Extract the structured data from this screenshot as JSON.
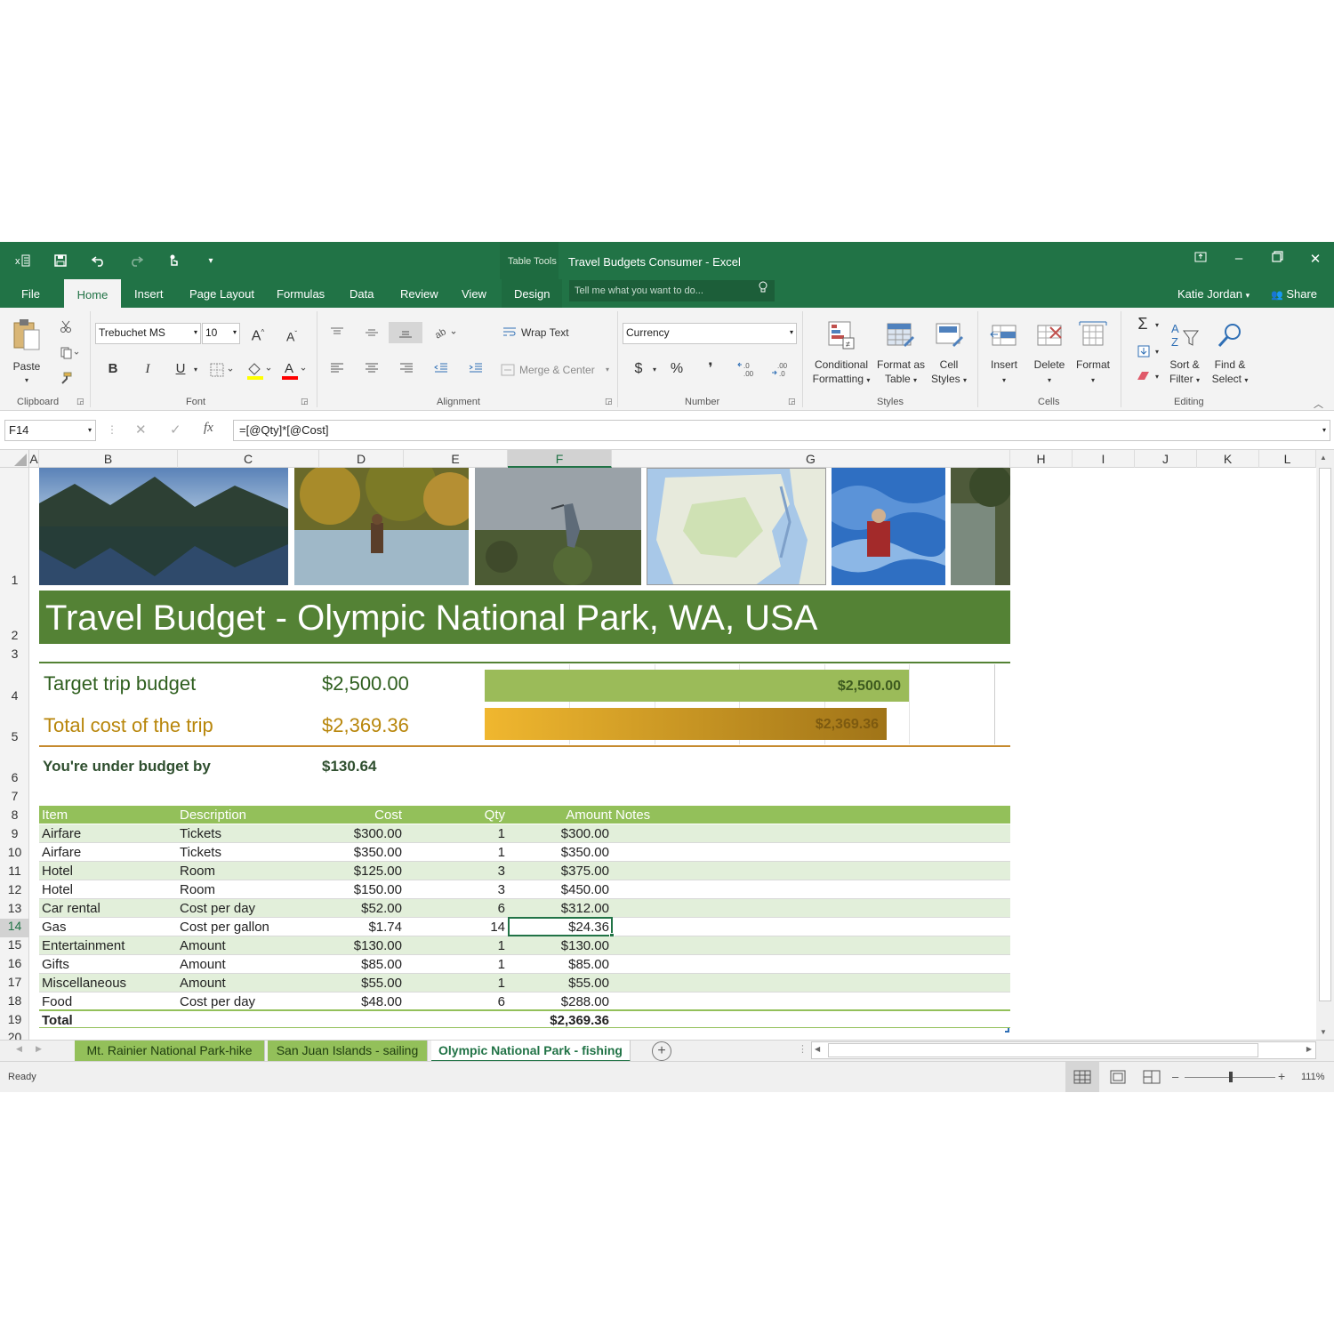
{
  "window": {
    "title": "Travel Budgets Consumer - Excel",
    "context_tab_group": "Table Tools",
    "user": "Katie Jordan",
    "share": "Share",
    "tell_me_placeholder": "Tell me what you want to do..."
  },
  "ribbon_tabs": [
    "File",
    "Home",
    "Insert",
    "Page Layout",
    "Formulas",
    "Data",
    "Review",
    "View",
    "Design"
  ],
  "active_tab": "Home",
  "ribbon": {
    "clipboard": {
      "paste": "Paste",
      "label": "Clipboard"
    },
    "font": {
      "name": "Trebuchet MS",
      "size": "10",
      "label": "Font",
      "bold": "B",
      "italic": "I",
      "underline": "U"
    },
    "alignment": {
      "wrap": "Wrap Text",
      "merge": "Merge & Center",
      "label": "Alignment"
    },
    "number": {
      "format": "Currency",
      "label": "Number",
      "dollar": "$",
      "percent": "%",
      "comma": "❜"
    },
    "styles": {
      "conditional": [
        "Conditional",
        "Formatting"
      ],
      "format_table": [
        "Format as",
        "Table"
      ],
      "cell_styles": [
        "Cell",
        "Styles"
      ],
      "label": "Styles"
    },
    "cells": {
      "insert": "Insert",
      "delete": "Delete",
      "format": "Format",
      "label": "Cells"
    },
    "editing": {
      "sort": [
        "Sort &",
        "Filter"
      ],
      "find": [
        "Find &",
        "Select"
      ],
      "label": "Editing"
    }
  },
  "formula_bar": {
    "name_box": "F14",
    "formula": "=[@Qty]*[@Cost]"
  },
  "columns": [
    "A",
    "B",
    "C",
    "D",
    "E",
    "F",
    "G",
    "H",
    "I",
    "J",
    "K",
    "L"
  ],
  "rows": [
    "1",
    "2",
    "3",
    "4",
    "5",
    "6",
    "7",
    "8",
    "9",
    "10",
    "11",
    "12",
    "13",
    "14",
    "15",
    "16",
    "17",
    "18",
    "19",
    "20"
  ],
  "selected_cell": {
    "column": "F",
    "row": "14"
  },
  "sheet": {
    "title": "Travel Budget - Olympic National Park, WA, USA",
    "target_label": "Target trip budget",
    "target_value": "$2,500.00",
    "total_label": "Total cost of the trip",
    "total_value": "$2,369.36",
    "under_label": "You're under budget by",
    "under_value": "$130.64",
    "bar_target": "$2,500.00",
    "bar_total": "$2,369.36",
    "table_headers": {
      "item": "Item",
      "description": "Description",
      "cost": "Cost",
      "qty": "Qty",
      "amount": "Amount",
      "notes": "Notes"
    },
    "table_rows": [
      {
        "item": "Airfare",
        "description": "Tickets",
        "cost": "$300.00",
        "qty": "1",
        "amount": "$300.00"
      },
      {
        "item": "Airfare",
        "description": "Tickets",
        "cost": "$350.00",
        "qty": "1",
        "amount": "$350.00"
      },
      {
        "item": "Hotel",
        "description": "Room",
        "cost": "$125.00",
        "qty": "3",
        "amount": "$375.00"
      },
      {
        "item": "Hotel",
        "description": "Room",
        "cost": "$150.00",
        "qty": "3",
        "amount": "$450.00"
      },
      {
        "item": "Car rental",
        "description": "Cost per day",
        "cost": "$52.00",
        "qty": "6",
        "amount": "$312.00"
      },
      {
        "item": "Gas",
        "description": "Cost per gallon",
        "cost": "$1.74",
        "qty": "14",
        "amount": "$24.36"
      },
      {
        "item": "Entertainment",
        "description": "Amount",
        "cost": "$130.00",
        "qty": "1",
        "amount": "$130.00"
      },
      {
        "item": "Gifts",
        "description": "Amount",
        "cost": "$85.00",
        "qty": "1",
        "amount": "$85.00"
      },
      {
        "item": "Miscellaneous",
        "description": "Amount",
        "cost": "$55.00",
        "qty": "1",
        "amount": "$55.00"
      },
      {
        "item": "Food",
        "description": "Cost per day",
        "cost": "$48.00",
        "qty": "6",
        "amount": "$288.00"
      }
    ],
    "total_row": {
      "item": "Total",
      "amount": "$2,369.36"
    }
  },
  "sheet_tabs": [
    "Mt. Rainier National Park-hike",
    "San Juan Islands - sailing",
    "Olympic National Park - fishing"
  ],
  "active_sheet": "Olympic National Park - fishing",
  "status": {
    "ready": "Ready",
    "zoom": "111%"
  },
  "colors": {
    "brand": "#217346",
    "banner": "#548235",
    "table_header": "#93c05a",
    "band": "#e2efda",
    "gold": "#b8860b",
    "target_bar": "#9bbb59"
  }
}
